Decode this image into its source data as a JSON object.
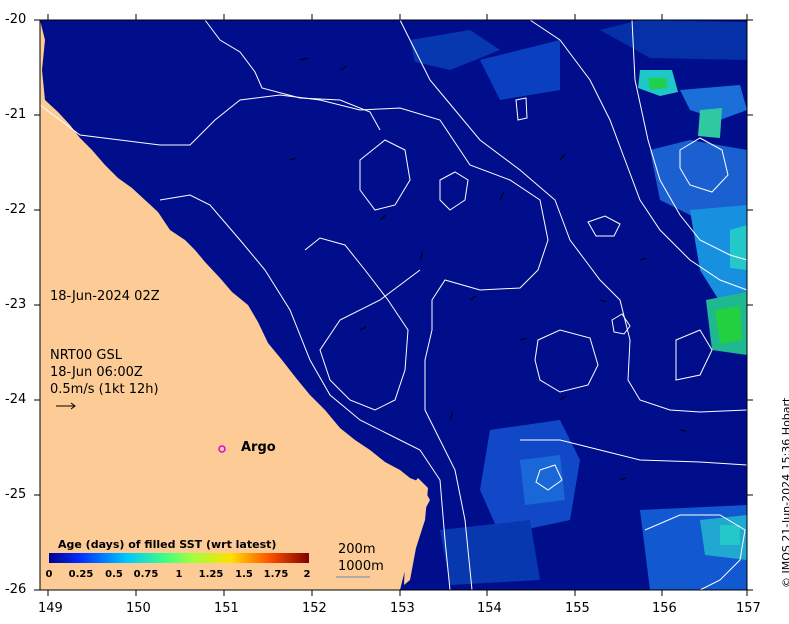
{
  "x_ticks": [
    "149",
    "150",
    "151",
    "152",
    "153",
    "154",
    "155",
    "156",
    "157"
  ],
  "y_ticks": [
    "-20",
    "-21",
    "-22",
    "-23",
    "-24",
    "-25",
    "-26"
  ],
  "date_label": "18-Jun-2024 02Z",
  "current_model": "NRT00 GSL",
  "current_time": "18-Jun 06:00Z",
  "current_scale": "0.5m/s (1kt 12h)",
  "argo_label": "Argo",
  "colorbar": {
    "title": "Age (days) of filled SST (wrt latest)",
    "ticks": [
      "0",
      "0.25",
      "0.5",
      "0.75",
      "1",
      "1.25",
      "1.5",
      "1.75",
      "2"
    ]
  },
  "isobaths": [
    "200m",
    "1000m"
  ],
  "credit": "© IMOS 21-Jun-2024 15:36 Hobart",
  "colors": {
    "ocean": "#000e8c",
    "land": "#fccb96",
    "argo": "#e000e0"
  }
}
